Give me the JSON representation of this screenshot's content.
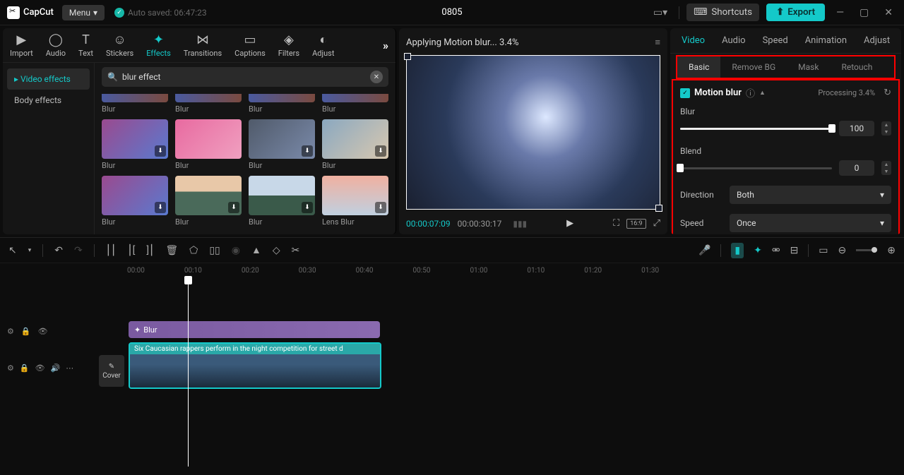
{
  "app": {
    "name": "CapCut",
    "menu": "Menu",
    "autosave": "Auto saved: 06:47:23",
    "project": "0805"
  },
  "topbar": {
    "shortcuts": "Shortcuts",
    "export": "Export"
  },
  "toolnav": {
    "items": [
      "Import",
      "Audio",
      "Text",
      "Stickers",
      "Effects",
      "Transitions",
      "Captions",
      "Filters",
      "Adjust"
    ],
    "active": "Effects"
  },
  "effect_cats": {
    "video": "Video effects",
    "body": "Body effects"
  },
  "search": {
    "placeholder": "Search",
    "value": "blur effect"
  },
  "effects": {
    "row0": [
      "Blur",
      "Blur",
      "Blur",
      "Blur"
    ],
    "row1": [
      "Blur",
      "Blur",
      "Blur",
      "Blur"
    ],
    "row2": [
      "Blur",
      "Blur",
      "Blur",
      "Lens Blur"
    ]
  },
  "preview": {
    "title": "Applying Motion blur... 3.4%",
    "time": "00:00:07:09",
    "duration": "00:00:30:17",
    "ratio": "16:9"
  },
  "props": {
    "tabs": [
      "Video",
      "Audio",
      "Speed",
      "Animation",
      "Adjust"
    ],
    "subtabs": [
      "Basic",
      "Remove BG",
      "Mask",
      "Retouch"
    ],
    "title": "Motion blur",
    "processing": "Processing 3.4%",
    "blur": {
      "label": "Blur",
      "value": "100"
    },
    "blend": {
      "label": "Blend",
      "value": "0"
    },
    "direction": {
      "label": "Direction",
      "value": "Both"
    },
    "speed": {
      "label": "Speed",
      "value": "Once"
    }
  },
  "ruler": [
    "00:00",
    "00:10",
    "00:20",
    "00:30",
    "00:40",
    "00:50",
    "01:00",
    "01:10",
    "01:20",
    "01:30"
  ],
  "timeline": {
    "fx_clip": "Blur",
    "video_clip": "Six Caucasian rappers perform in the night competition for street d",
    "cover": "Cover"
  }
}
